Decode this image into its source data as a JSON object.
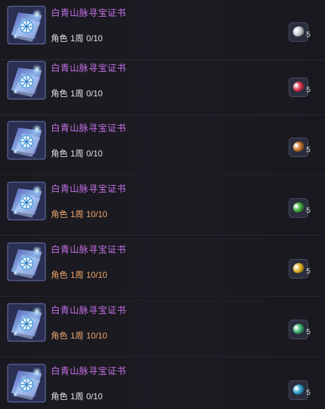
{
  "items": [
    {
      "title": "白青山脉寻宝证书",
      "role": "角色",
      "period": "1周",
      "count": "0/10",
      "done": false,
      "reward_count": "5",
      "reward_color": "#d9304f"
    },
    {
      "title": "白青山脉寻宝证书",
      "role": "角色",
      "period": "1周",
      "count": "0/10",
      "done": false,
      "reward_count": "5",
      "reward_color": "#c8742a"
    },
    {
      "title": "白青山脉寻宝证书",
      "role": "角色",
      "period": "1周",
      "count": "10/10",
      "done": true,
      "reward_count": "5",
      "reward_color": "#3fa83a"
    },
    {
      "title": "白青山脉寻宝证书",
      "role": "角色",
      "period": "1周",
      "count": "10/10",
      "done": true,
      "reward_count": "5",
      "reward_color": "#e0b020"
    },
    {
      "title": "白青山脉寻宝证书",
      "role": "角色",
      "period": "1周",
      "count": "10/10",
      "done": true,
      "reward_count": "5",
      "reward_color": "#38b070"
    },
    {
      "title": "白青山脉寻宝证书",
      "role": "角色",
      "period": "1周",
      "count": "0/10",
      "done": false,
      "reward_count": "5",
      "reward_color": "#2f9fd0"
    },
    {
      "title": "白青山脉寻宝证书",
      "role": "角色",
      "period": "1周",
      "count": "0/10",
      "done": false,
      "reward_count": "5",
      "reward_color": "#c9ccd4"
    }
  ],
  "icons": {
    "item": "treasure-certificate-icon",
    "reward": "gem-reward-icon"
  }
}
